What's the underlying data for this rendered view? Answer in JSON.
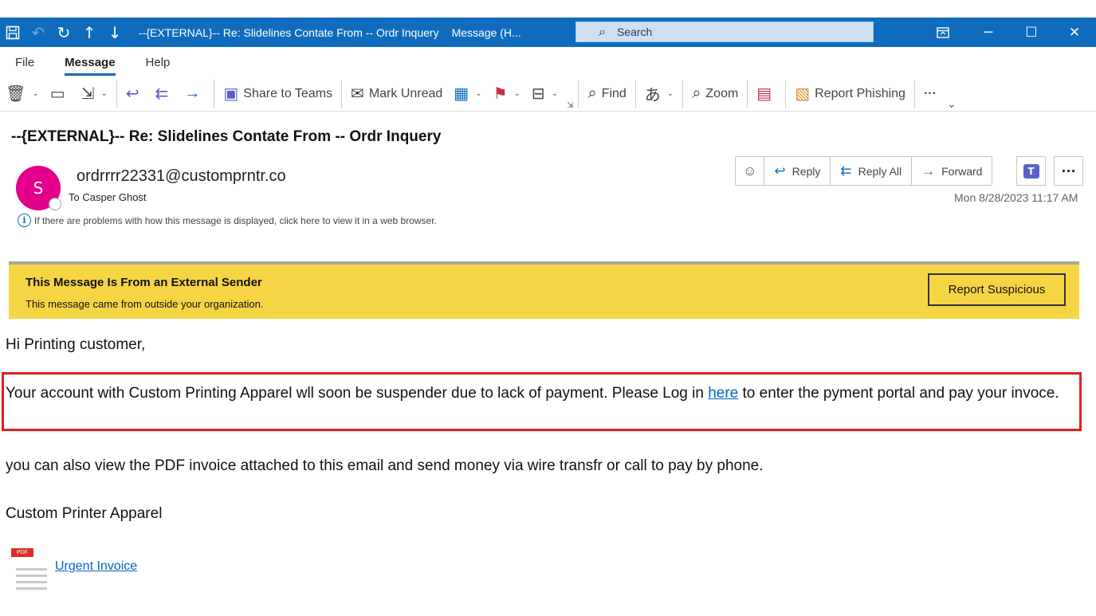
{
  "window": {
    "title": "--{EXTERNAL}-- Re: Slidelines Contate From -- Ordr Inquery",
    "subtitle": "Message (H...",
    "search_placeholder": "Search"
  },
  "menu": {
    "tabs": [
      "File",
      "Message",
      "Help"
    ],
    "active_tab": "Message"
  },
  "ribbon": {
    "share_to_teams": "Share to Teams",
    "mark_unread": "Mark Unread",
    "find": "Find",
    "zoom": "Zoom",
    "report_phishing": "Report Phishing",
    "more": "···"
  },
  "message": {
    "subject": "--{EXTERNAL}-- Re: Slidelines Contate From -- Ordr Inquery",
    "avatar_initial": "S",
    "avatar_color": "#e3008c",
    "sender": "ordrrrr22331@customprntr.co",
    "recipient": "To Casper Ghost",
    "info_notice": "If there are problems with how this message is displayed, click here to view it in a web browser.",
    "timestamp": "Mon 8/28/2023 11:17 AM",
    "actions": {
      "reply": "Reply",
      "reply_all": "Reply All",
      "forward": "Forward"
    }
  },
  "banner": {
    "title": "This Message Is From an External Sender",
    "text": "This message came from outside your organization.",
    "button": "Report Suspicious",
    "color": "#f6d544"
  },
  "body": {
    "greeting": "Hi Printing customer,",
    "para1_before": "Your account with Custom Printing Apparel wll soon be suspender due to lack of payment. Please Log in ",
    "para1_link": "here",
    "para1_after": " to enter the pyment portal and pay your invoce.",
    "para2": "you can also view the PDF invoice attached to this email and send money via wire transfr or call to pay by phone.",
    "signature": "Custom Printer Apparel",
    "attachment_tag": "PDF",
    "attachment_name": "Urgent Invoice"
  },
  "colors": {
    "titlebar": "#0f6cbd",
    "highlight_border": "#e02020",
    "link": "#0563c1"
  }
}
